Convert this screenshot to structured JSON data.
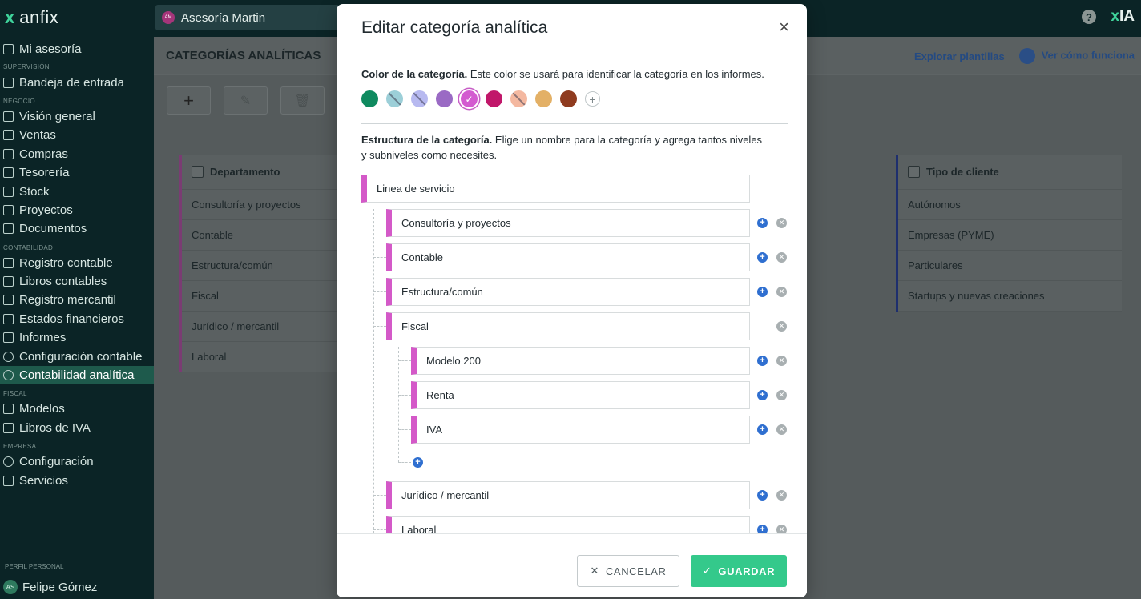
{
  "app": {
    "name": "anfix",
    "logo_mark": "x"
  },
  "company": {
    "name": "Asesoría Martin",
    "badge": "AM"
  },
  "topbar": {
    "help": "?",
    "ia_label": "IA"
  },
  "sidebar": {
    "top_item": "Mi asesoría",
    "sections": [
      {
        "label": "SUPERVISIÓN",
        "items": [
          "Bandeja de entrada"
        ]
      },
      {
        "label": "NEGOCIO",
        "items": [
          "Visión general",
          "Ventas",
          "Compras",
          "Tesorería",
          "Stock",
          "Proyectos",
          "Documentos"
        ]
      },
      {
        "label": "CONTABILIDAD",
        "items": [
          "Registro contable",
          "Libros contables",
          "Registro mercantil",
          "Estados financieros",
          "Informes",
          "Configuración contable",
          "Contabilidad analítica"
        ]
      },
      {
        "label": "FISCAL",
        "items": [
          "Modelos",
          "Libros de IVA"
        ]
      },
      {
        "label": "EMPRESA",
        "items": [
          "Configuración",
          "Servicios"
        ]
      }
    ],
    "active": "Contabilidad analítica",
    "profile_section": "PERFIL PERSONAL",
    "profile_name": "Felipe Gómez",
    "profile_initials": "AS"
  },
  "main": {
    "title": "CATEGORÍAS ANALÍTICAS",
    "explore_link": "Explorar plantillas",
    "how_link": "Ver cómo funciona",
    "toolbar": {
      "add": "+",
      "edit": "✎",
      "delete": "🗑"
    },
    "card_left": {
      "header": "Departamento",
      "rows": [
        "Consultoría y proyectos",
        "Contable",
        "Estructura/común",
        "Fiscal",
        "Jurídico / mercantil",
        "Laboral"
      ]
    },
    "card_right": {
      "header": "Tipo de cliente",
      "rows": [
        "Autónomos",
        "Empresas (PYME)",
        "Particulares",
        "Startups y nuevas creaciones"
      ]
    }
  },
  "modal": {
    "title": "Editar categoría analítica",
    "close": "×",
    "color_section": {
      "bold": "Color de la categoría.",
      "text": " Este color se usará para identificar la categoría en los informes."
    },
    "colors": [
      "#0f8a5f",
      "#9ccfd8",
      "#b7b9f0",
      "#9a6ac4",
      "#d35bd0",
      "#c1176a",
      "#f4b8a0",
      "#e3b066",
      "#8f3b1f"
    ],
    "selected_color": "#d35bd0",
    "add_color": "+",
    "structure_section": {
      "bold": "Estructura de la categoría.",
      "text": " Elige un nombre para la categoría y agrega tantos niveles y subniveles como necesites."
    },
    "root": "Linea de servicio",
    "level1": [
      "Consultoría y proyectos",
      "Contable",
      "Estructura/común",
      "Fiscal",
      "Jurídico / mercantil",
      "Laboral"
    ],
    "fiscal_children": [
      "Modelo 200",
      "Renta",
      "IVA"
    ],
    "cancel_label": "CANCELAR",
    "save_label": "GUARDAR"
  }
}
